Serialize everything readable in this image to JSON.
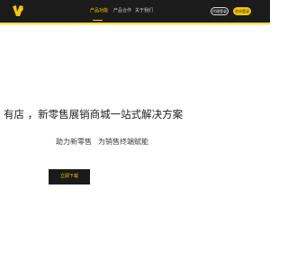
{
  "header": {
    "nav": {
      "product_label": "产品功能",
      "partner_label": "产品合作",
      "about_label": "关于我们"
    },
    "login_label": "代理登录",
    "join_label": "合伙登录"
  },
  "hero": {
    "headline": "有店 ，新零售展销商城一站式解决方案",
    "sub_1": "助力新零售",
    "sub_2": "为销售终端赋能",
    "download_label": "立即下载"
  },
  "colors": {
    "accent": "#f7c600",
    "header_bg": "#1b1b1b",
    "button_bg": "#1a1a1a"
  },
  "icons": {
    "logo": "brand-logo-icon"
  }
}
